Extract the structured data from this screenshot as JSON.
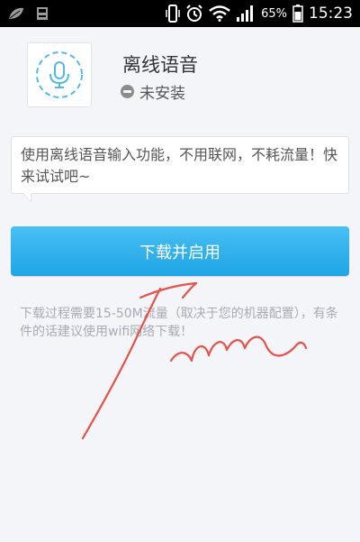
{
  "status_bar": {
    "battery_percent": "65%",
    "time": "15:23",
    "icons": [
      "leaf-icon",
      "storage-icon",
      "vibrate-icon",
      "alarm-icon",
      "wifi-icon",
      "signal-icon",
      "battery-icon"
    ]
  },
  "header": {
    "title": "离线语音",
    "status": "未安装",
    "icon": "microphone-icon"
  },
  "description": "使用离线语音输入功能，不用联网，不耗流量！快来试试吧~",
  "button": {
    "label": "下载并启用"
  },
  "note": "下载过程需要15-50M流量（取决于您的机器配置），有条件的话建议使用wifi网络下载！",
  "colors": {
    "accent": "#2eb1ee",
    "background": "#f3f5f8",
    "annotation": "#e8504a"
  }
}
